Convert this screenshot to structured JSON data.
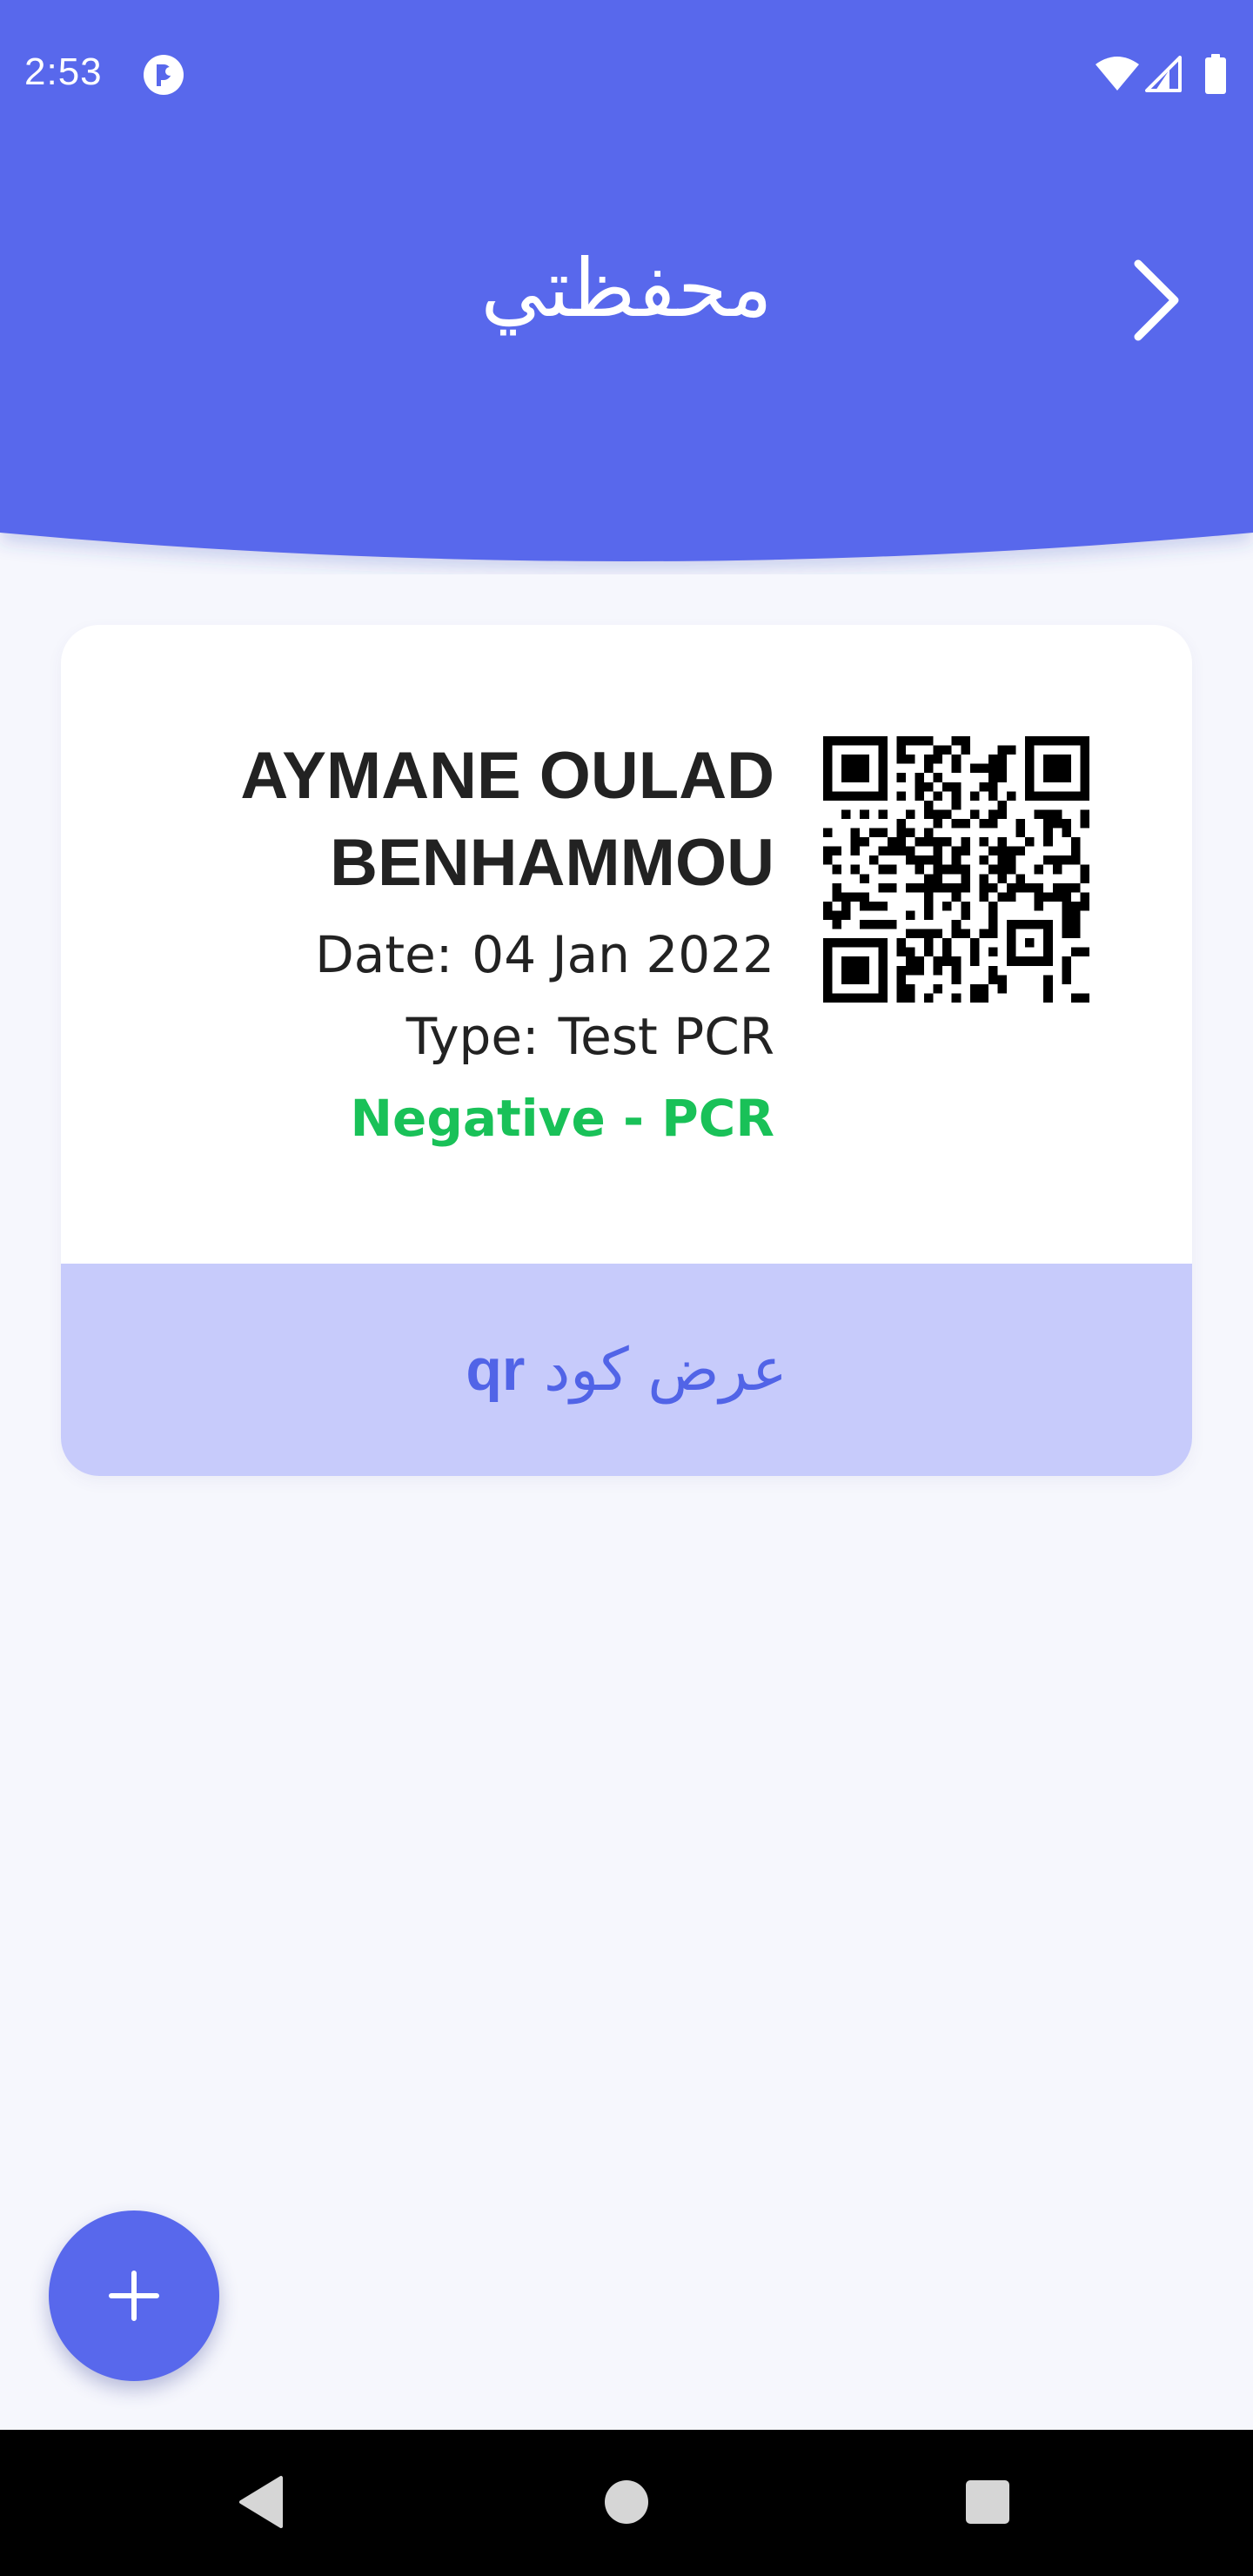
{
  "status_bar": {
    "time": "2:53",
    "icons": [
      "app-notification-icon",
      "wifi-icon",
      "cell-signal-icon",
      "battery-icon"
    ]
  },
  "header": {
    "title": "محفظتي",
    "back_icon": "chevron-right-icon"
  },
  "card": {
    "name_line1": "AYMANE OULAD",
    "name_line2": "BENHAMMOU",
    "date_label": "Date:",
    "date_value": "04 Jan 2022",
    "type_label": "Type:",
    "type_value": "Test PCR",
    "result": "Negative - PCR",
    "qr_icon": "qr-code",
    "show_qr_arabic": "عرض كود",
    "show_qr_latin": "qr"
  },
  "fab": {
    "icon": "plus-icon"
  },
  "nav": {
    "icons": [
      "back-triangle-icon",
      "home-circle-icon",
      "recents-square-icon"
    ]
  },
  "colors": {
    "header": "#5868ec",
    "background": "#f6f7fd",
    "result_green": "#19c158",
    "qr_button_bg": "#c7cbfb",
    "qr_button_text": "#5164e7"
  }
}
